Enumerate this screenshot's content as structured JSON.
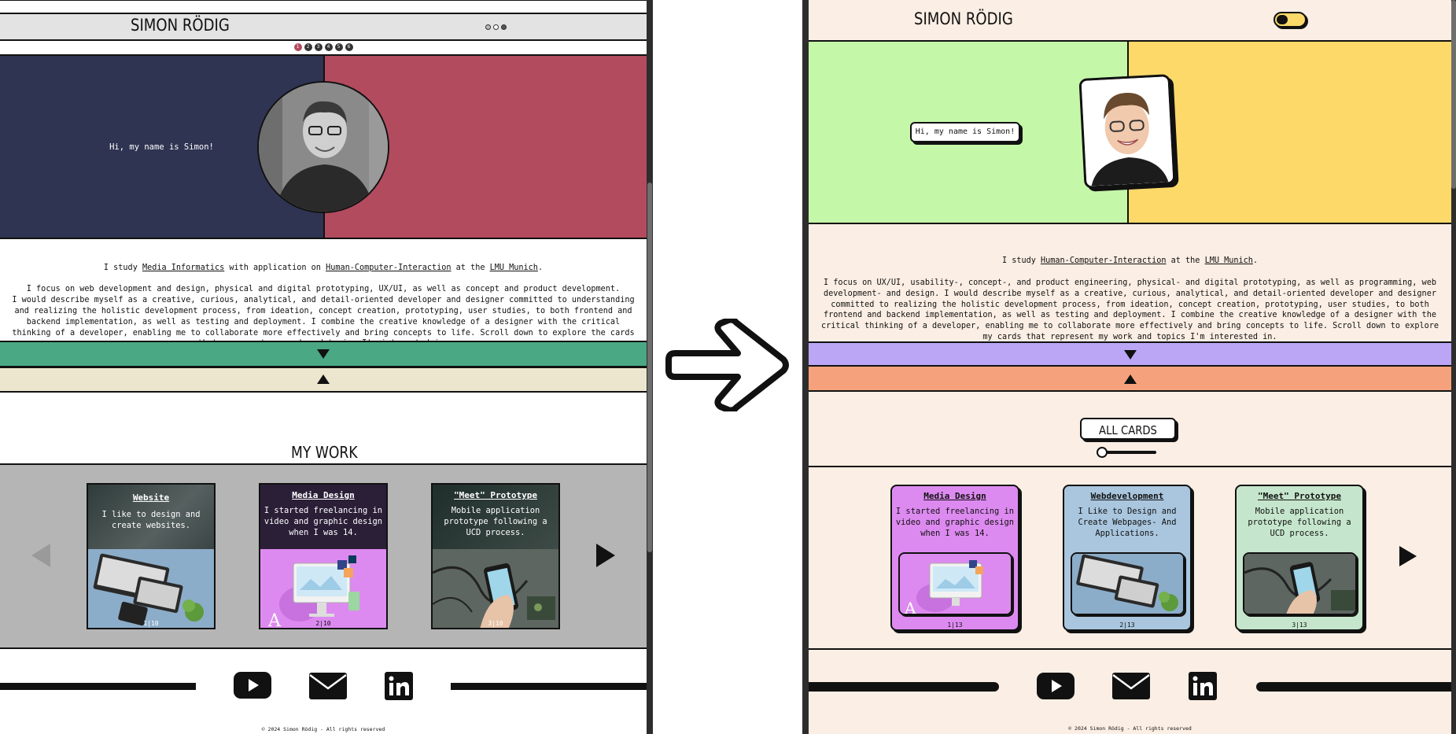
{
  "site": {
    "logo": "SIMON RÖDIG",
    "greeting": "Hi, my name is Simon!",
    "footer": "© 2024 Simon Rödig - All rights reserved"
  },
  "left": {
    "bio": {
      "l1a": "I study ",
      "l1b": "Media Informatics",
      "l1c": " with application on ",
      "l1d": "Human-Computer-Interaction",
      "l1e": " at the ",
      "l1f": "LMU Munich",
      "l1g": ".",
      "rest": "I focus on web development and design, physical and digital prototyping, UX/UI, as well as concept and product development.\nI would describe myself as a creative, curious, analytical, and detail-oriented developer and designer committed to understanding\nand realizing the holistic development process, from ideation, concept creation, prototyping, user studies, to both frontend and\nbackend implementation, as well as testing and deployment. I combine the creative knowledge of a designer with the critical\nthinking of a developer, enabling me to collaborate more effectively and bring concepts to life. Scroll down to explore the cards\nthat represent my work and topics I'm interested in."
    },
    "pagination": [
      "1",
      "2",
      "3",
      "4",
      "5",
      "6"
    ],
    "section_title": "MY WORK",
    "cards": [
      {
        "title": "Website",
        "desc": "I like to design and\ncreate websites.",
        "num": "1|10"
      },
      {
        "title": "Media Design",
        "desc": "I started freelancing in\nvideo and graphic design\nwhen I was 14.",
        "num": "2|10"
      },
      {
        "title": "\"Meet\" Prototype",
        "desc": "Mobile application\nprototype following a\nUCD process.",
        "num": "3|10"
      }
    ],
    "colors": {
      "navy": "#2f3452",
      "red": "#b24b5e",
      "green": "#4aa884",
      "cream": "#ede6cf",
      "carousel": "#b5b5b5"
    }
  },
  "right": {
    "bio": {
      "l1a": "I study ",
      "l1b": "Human-Computer-Interaction",
      "l1c": " at the ",
      "l1d": "LMU Munich",
      "l1e": ".",
      "rest": "I focus on UX/UI, usability-, concept-, and product engineering, physical- and digital prototyping, as well as programming, web\ndevelopment- and design. I would describe myself as a creative, curious, analytical, and detail-oriented developer and designer\ncommitted to realizing the holistic development process, from ideation, concept creation, prototyping, user studies, to both\nfrontend and backend implementation, as well as testing and deployment. I combine the creative knowledge of a designer with the\ncritical thinking of a developer, enabling me to collaborate more effectively and bring concepts to life. Scroll down to explore\nmy cards that represent my work and topics I'm interested in."
    },
    "all_cards_label": "ALL CARDS",
    "cards": [
      {
        "title": "Media Design",
        "desc": "I started freelancing in\nvideo and graphic design\nwhen I was 14.",
        "num": "1|13"
      },
      {
        "title": "Webdevelopment",
        "desc": "I Like to Design and\nCreate Webpages- And\nApplications.",
        "num": "2|13"
      },
      {
        "title": "\"Meet\" Prototype",
        "desc": "Mobile application\nprototype following a\nUCD process.",
        "num": "3|13"
      }
    ],
    "colors": {
      "green": "#c5f7a9",
      "yellow": "#fdd96a",
      "purple": "#bba6f6",
      "orange": "#f5a27c",
      "bg": "#fbeee4"
    }
  },
  "icons": [
    "youtube-icon",
    "mail-icon",
    "linkedin-icon",
    "arrow-right-icon"
  ]
}
